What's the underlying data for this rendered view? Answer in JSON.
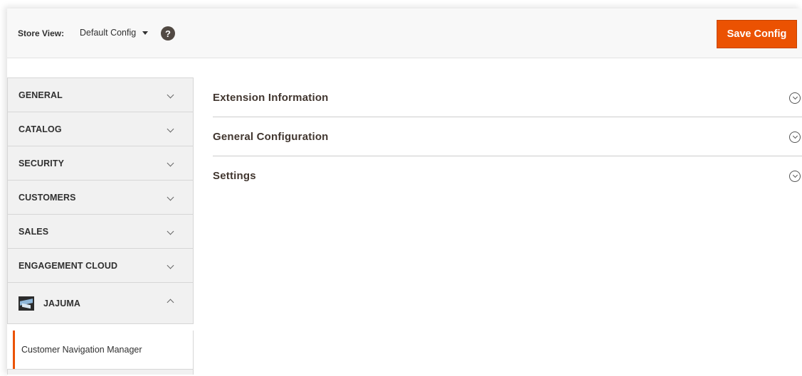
{
  "header": {
    "store_view_label": "Store View:",
    "store_view_value": "Default Config",
    "help_glyph": "?",
    "save_label": "Save Config"
  },
  "sidebar": {
    "items": [
      {
        "label": "GENERAL"
      },
      {
        "label": "CATALOG"
      },
      {
        "label": "SECURITY"
      },
      {
        "label": "CUSTOMERS"
      },
      {
        "label": "SALES"
      },
      {
        "label": "ENGAGEMENT CLOUD"
      }
    ],
    "open_item": {
      "label": "JAJUMA",
      "logo": "jajuma-logo"
    },
    "sub_item": {
      "label": "Customer Navigation Manager"
    }
  },
  "main": {
    "sections": [
      {
        "title": "Extension Information"
      },
      {
        "title": "General Configuration"
      },
      {
        "title": "Settings"
      }
    ]
  },
  "colors": {
    "accent": "#eb5202",
    "sidebar_bg": "#f1f1f1",
    "text": "#303030"
  }
}
